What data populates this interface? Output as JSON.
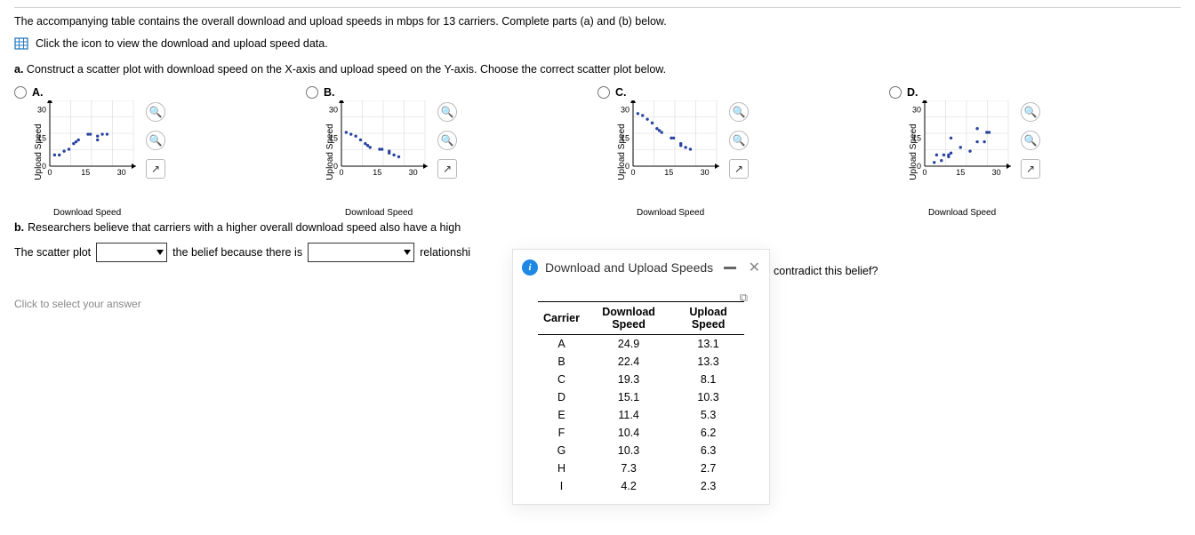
{
  "intro": "The accompanying table contains the overall download and upload speeds in mbps for 13 carriers. Complete parts (a) and (b) below.",
  "data_link": "Click the icon to view the download and upload speed data.",
  "part_a": {
    "prefix": "a.",
    "text": "Construct a scatter plot with download speed on the X-axis and upload speed on the Y-axis. Choose the correct scatter plot below."
  },
  "options": [
    "A.",
    "B.",
    "C.",
    "D."
  ],
  "chart_meta": {
    "ylabel": "Upload Speed",
    "xlabel": "Download Speed",
    "ticks_x": [
      "0",
      "15",
      "30"
    ],
    "ticks_y": [
      "0",
      "15",
      "30"
    ]
  },
  "part_b": {
    "prefix": "b.",
    "text_before": "Researchers believe that carriers with a higher overall download speed also have a high",
    "text_after": "contradict this belief?"
  },
  "answer_line": {
    "t1": "The scatter plot",
    "t2": "the belief because there is",
    "t3": "relationshi"
  },
  "click_select": "Click to select your answer",
  "dialog": {
    "title": "Download and Upload Speeds"
  },
  "table": {
    "headers": [
      "Carrier",
      "Download Speed",
      "Upload Speed"
    ],
    "rows": [
      [
        "A",
        "24.9",
        "13.1"
      ],
      [
        "B",
        "22.4",
        "13.3"
      ],
      [
        "C",
        "19.3",
        "8.1"
      ],
      [
        "D",
        "15.1",
        "10.3"
      ],
      [
        "E",
        "11.4",
        "5.3"
      ],
      [
        "F",
        "10.4",
        "6.2"
      ],
      [
        "G",
        "10.3",
        "6.3"
      ],
      [
        "H",
        "7.3",
        "2.7"
      ],
      [
        "I",
        "4.2",
        "2.3"
      ]
    ]
  },
  "chart_data": [
    {
      "type": "scatter",
      "id": "A",
      "xlabel": "Download Speed",
      "ylabel": "Upload Speed",
      "xlim": [
        0,
        35
      ],
      "ylim": [
        0,
        35
      ],
      "points": [
        [
          2,
          6
        ],
        [
          4,
          6
        ],
        [
          6,
          8
        ],
        [
          8,
          9
        ],
        [
          10,
          12
        ],
        [
          11,
          13
        ],
        [
          12,
          14
        ],
        [
          16,
          17
        ],
        [
          17,
          17
        ],
        [
          20,
          14
        ],
        [
          20,
          16
        ],
        [
          22,
          17
        ],
        [
          24,
          17
        ]
      ]
    },
    {
      "type": "scatter",
      "id": "B",
      "xlabel": "Download Speed",
      "ylabel": "Upload Speed",
      "xlim": [
        0,
        35
      ],
      "ylim": [
        0,
        35
      ],
      "points": [
        [
          2,
          18
        ],
        [
          4,
          17
        ],
        [
          6,
          16
        ],
        [
          8,
          14
        ],
        [
          10,
          12
        ],
        [
          11,
          11
        ],
        [
          12,
          10
        ],
        [
          16,
          9
        ],
        [
          17,
          9
        ],
        [
          20,
          8
        ],
        [
          20,
          7
        ],
        [
          22,
          6
        ],
        [
          24,
          5
        ]
      ]
    },
    {
      "type": "scatter",
      "id": "C",
      "xlabel": "Download Speed",
      "ylabel": "Upload Speed",
      "xlim": [
        0,
        35
      ],
      "ylim": [
        0,
        35
      ],
      "points": [
        [
          2,
          28
        ],
        [
          4,
          27
        ],
        [
          6,
          25
        ],
        [
          8,
          23
        ],
        [
          10,
          20
        ],
        [
          11,
          19
        ],
        [
          12,
          18
        ],
        [
          16,
          15
        ],
        [
          17,
          15
        ],
        [
          20,
          11
        ],
        [
          20,
          12
        ],
        [
          22,
          10
        ],
        [
          24,
          9
        ]
      ]
    },
    {
      "type": "scatter",
      "id": "D",
      "xlabel": "Download Speed",
      "ylabel": "Upload Speed",
      "xlim": [
        0,
        35
      ],
      "ylim": [
        0,
        35
      ],
      "points": [
        [
          4,
          2
        ],
        [
          5,
          6
        ],
        [
          7,
          3
        ],
        [
          8,
          6
        ],
        [
          10,
          5
        ],
        [
          10,
          6
        ],
        [
          11,
          15
        ],
        [
          11,
          7
        ],
        [
          15,
          10
        ],
        [
          19,
          8
        ],
        [
          22,
          20
        ],
        [
          22,
          13
        ],
        [
          25,
          13
        ],
        [
          26,
          18
        ],
        [
          27,
          18
        ]
      ]
    }
  ]
}
